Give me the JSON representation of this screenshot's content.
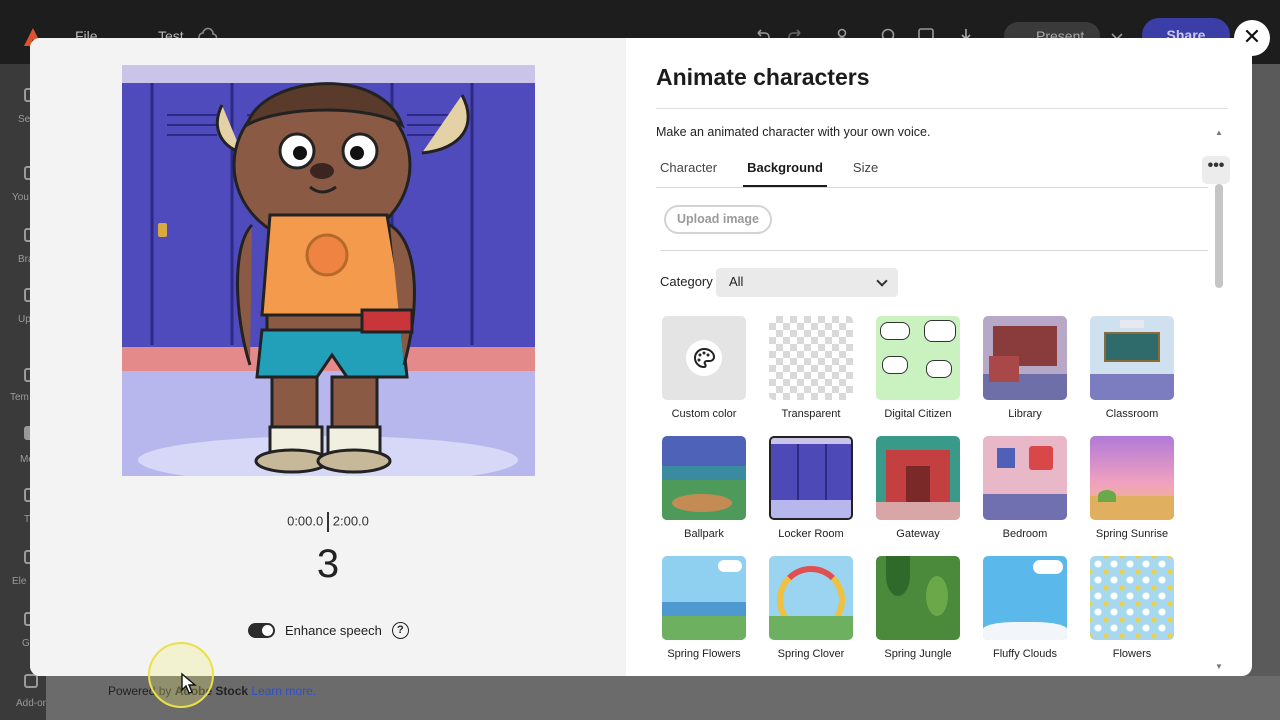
{
  "app": {
    "menu": {
      "file": "File",
      "doc_title": "Test"
    },
    "present_label": "Present",
    "share_label": "Share",
    "rail_items": [
      "Se",
      "You",
      "Bra",
      "Up",
      "Tem",
      "Me",
      "T",
      "Ele",
      "G",
      "Add-ons"
    ],
    "powered_prefix": "Powered by ",
    "powered_brand": "Adobe Stock",
    "learn_more": "Learn more."
  },
  "preview": {
    "current_time": "0:00.0",
    "total_time": "2:00.0",
    "countdown": "3",
    "enhance_speech_label": "Enhance speech",
    "enhance_speech_on": true,
    "help_glyph": "?"
  },
  "panel": {
    "title": "Animate characters",
    "description": "Make an animated character with your own voice.",
    "tabs": [
      {
        "label": "Character",
        "active": false
      },
      {
        "label": "Background",
        "active": true
      },
      {
        "label": "Size",
        "active": false
      }
    ],
    "more_glyph": "•••",
    "upload_label": "Upload image",
    "category_label": "Category",
    "category_value": "All",
    "backgrounds": [
      {
        "label": "Custom color",
        "icon": "palette-icon"
      },
      {
        "label": "Transparent"
      },
      {
        "label": "Digital Citizen"
      },
      {
        "label": "Library"
      },
      {
        "label": "Classroom"
      },
      {
        "label": "Ballpark"
      },
      {
        "label": "Locker Room",
        "selected": true
      },
      {
        "label": "Gateway"
      },
      {
        "label": "Bedroom"
      },
      {
        "label": "Spring Sunrise"
      },
      {
        "label": "Spring Flowers"
      },
      {
        "label": "Spring Clover"
      },
      {
        "label": "Spring Jungle"
      },
      {
        "label": "Fluffy Clouds"
      },
      {
        "label": "Flowers"
      }
    ]
  },
  "close_glyph": "✕",
  "colors": {
    "accent": "#3c3ea8",
    "locker_blue": "#4d4ab8",
    "link": "#2c4fcf"
  }
}
